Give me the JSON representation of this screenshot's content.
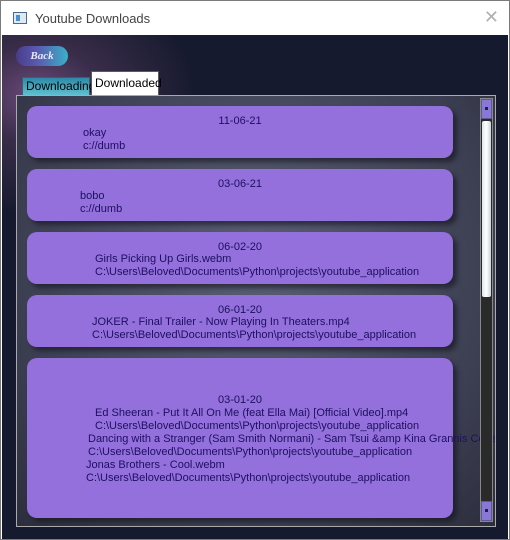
{
  "window": {
    "title": "Youtube Downloads",
    "close_glyph": "✕"
  },
  "toolbar": {
    "back_label": "Back"
  },
  "tabs": [
    {
      "label": "Downloading",
      "active": false
    },
    {
      "label": "Downloaded",
      "active": true
    }
  ],
  "downloads": [
    {
      "date": "11-06-21",
      "lines": [
        "okay",
        "c://dumb"
      ]
    },
    {
      "date": "03-06-21",
      "lines": [
        "bobo",
        "c://dumb"
      ]
    },
    {
      "date": "06-02-20",
      "lines": [
        "Girls Picking Up Girls.webm",
        "C:\\Users\\Beloved\\Documents\\Python\\projects\\youtube_application"
      ]
    },
    {
      "date": "06-01-20",
      "lines": [
        "JOKER - Final Trailer - Now Playing In Theaters.mp4",
        "C:\\Users\\Beloved\\Documents\\Python\\projects\\youtube_application"
      ]
    },
    {
      "date": "03-01-20",
      "lines": [
        "Ed Sheeran - Put It All On Me (feat Ella Mai) [Official Video].mp4",
        "C:\\Users\\Beloved\\Documents\\Python\\projects\\youtube_application",
        "Dancing with a Stranger (Sam Smith Normani) - Sam Tsui &amp Kina Grannis Cove",
        "C:\\Users\\Beloved\\Documents\\Python\\projects\\youtube_application",
        "Jonas Brothers - Cool.webm",
        "C:\\Users\\Beloved\\Documents\\Python\\projects\\youtube_application"
      ]
    }
  ],
  "colors": {
    "card": "#9370DB",
    "card_text": "#1d1060"
  }
}
